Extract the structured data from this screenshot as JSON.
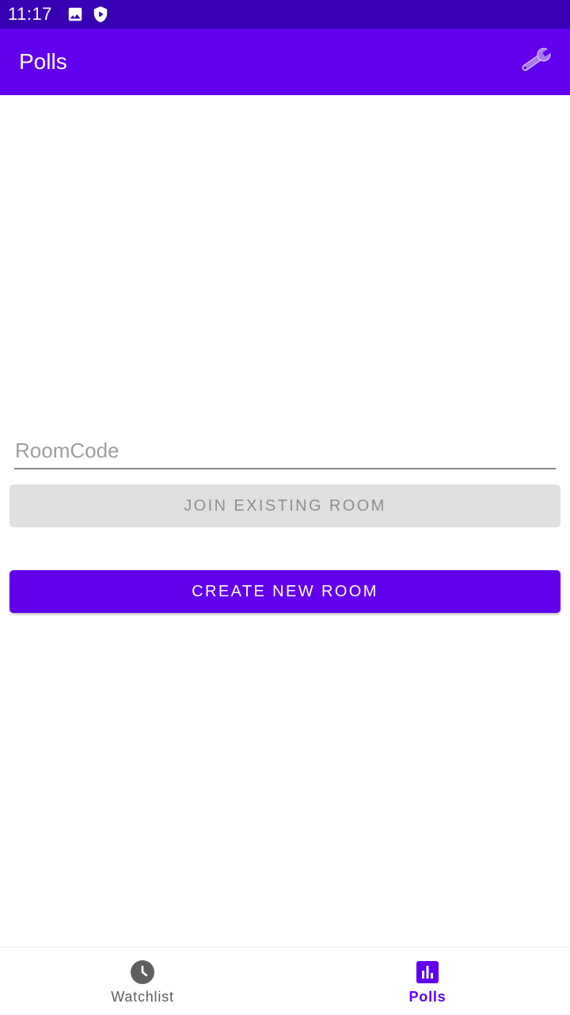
{
  "status_bar": {
    "time": "11:17",
    "icons": [
      "image-icon",
      "shield-play-icon"
    ]
  },
  "app_bar": {
    "title": "Polls",
    "action_icon": "wrench-icon"
  },
  "room_form": {
    "room_code_placeholder": "RoomCode",
    "room_code_value": "",
    "join_label": "JOIN EXISTING ROOM",
    "create_label": "CREATE NEW ROOM"
  },
  "bottom_nav": {
    "items": [
      {
        "label": "Watchlist",
        "icon": "clock-icon",
        "active": false
      },
      {
        "label": "Polls",
        "icon": "bar-chart-icon",
        "active": true
      }
    ]
  },
  "colors": {
    "primary": "#6200EE",
    "primary_dark": "#3700B3",
    "disabled_button": "#E0E0E0",
    "inactive_nav": "#5F5F5F"
  }
}
